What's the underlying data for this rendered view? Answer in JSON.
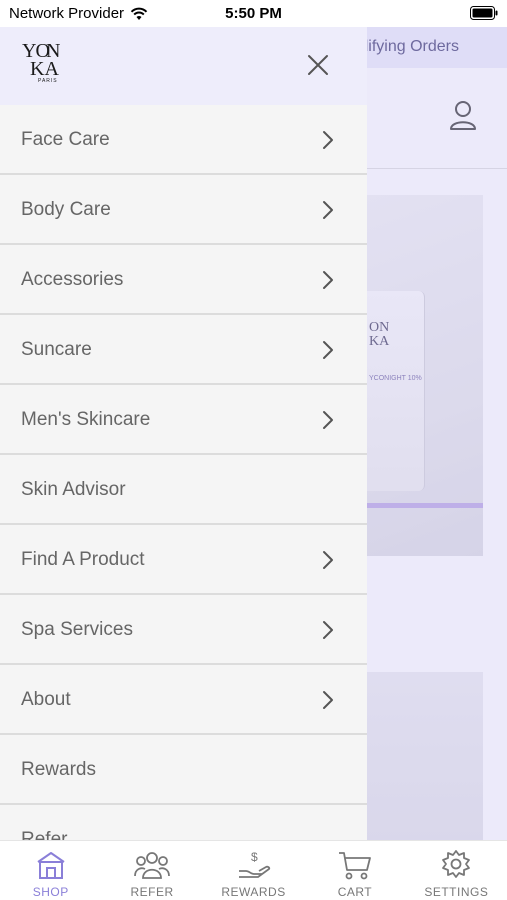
{
  "status_bar": {
    "carrier": "Network Provider",
    "time": "5:50 PM"
  },
  "background": {
    "promo_text": "lifying Orders"
  },
  "drawer": {
    "logo_alt": "YON KA PARIS",
    "items": [
      {
        "label": "Face Care",
        "has_chevron": true
      },
      {
        "label": "Body Care",
        "has_chevron": true
      },
      {
        "label": "Accessories",
        "has_chevron": true
      },
      {
        "label": "Suncare",
        "has_chevron": true
      },
      {
        "label": "Men's Skincare",
        "has_chevron": true
      },
      {
        "label": "Skin Advisor",
        "has_chevron": false
      },
      {
        "label": "Find A Product",
        "has_chevron": true
      },
      {
        "label": "Spa Services",
        "has_chevron": true
      },
      {
        "label": "About",
        "has_chevron": true
      },
      {
        "label": "Rewards",
        "has_chevron": false
      },
      {
        "label": "Refer",
        "has_chevron": false
      }
    ]
  },
  "tabbar": {
    "tabs": [
      {
        "label": "SHOP",
        "icon": "shop-icon",
        "active": true
      },
      {
        "label": "REFER",
        "icon": "refer-icon",
        "active": false
      },
      {
        "label": "REWARDS",
        "icon": "rewards-icon",
        "active": false
      },
      {
        "label": "CART",
        "icon": "cart-icon",
        "active": false
      },
      {
        "label": "SETTINGS",
        "icon": "settings-icon",
        "active": false
      }
    ]
  },
  "colors": {
    "accent": "#8a7fd8",
    "drawer_header": "#eeedfb",
    "promo_bar": "#ecebfa",
    "menu_text": "#666666"
  }
}
